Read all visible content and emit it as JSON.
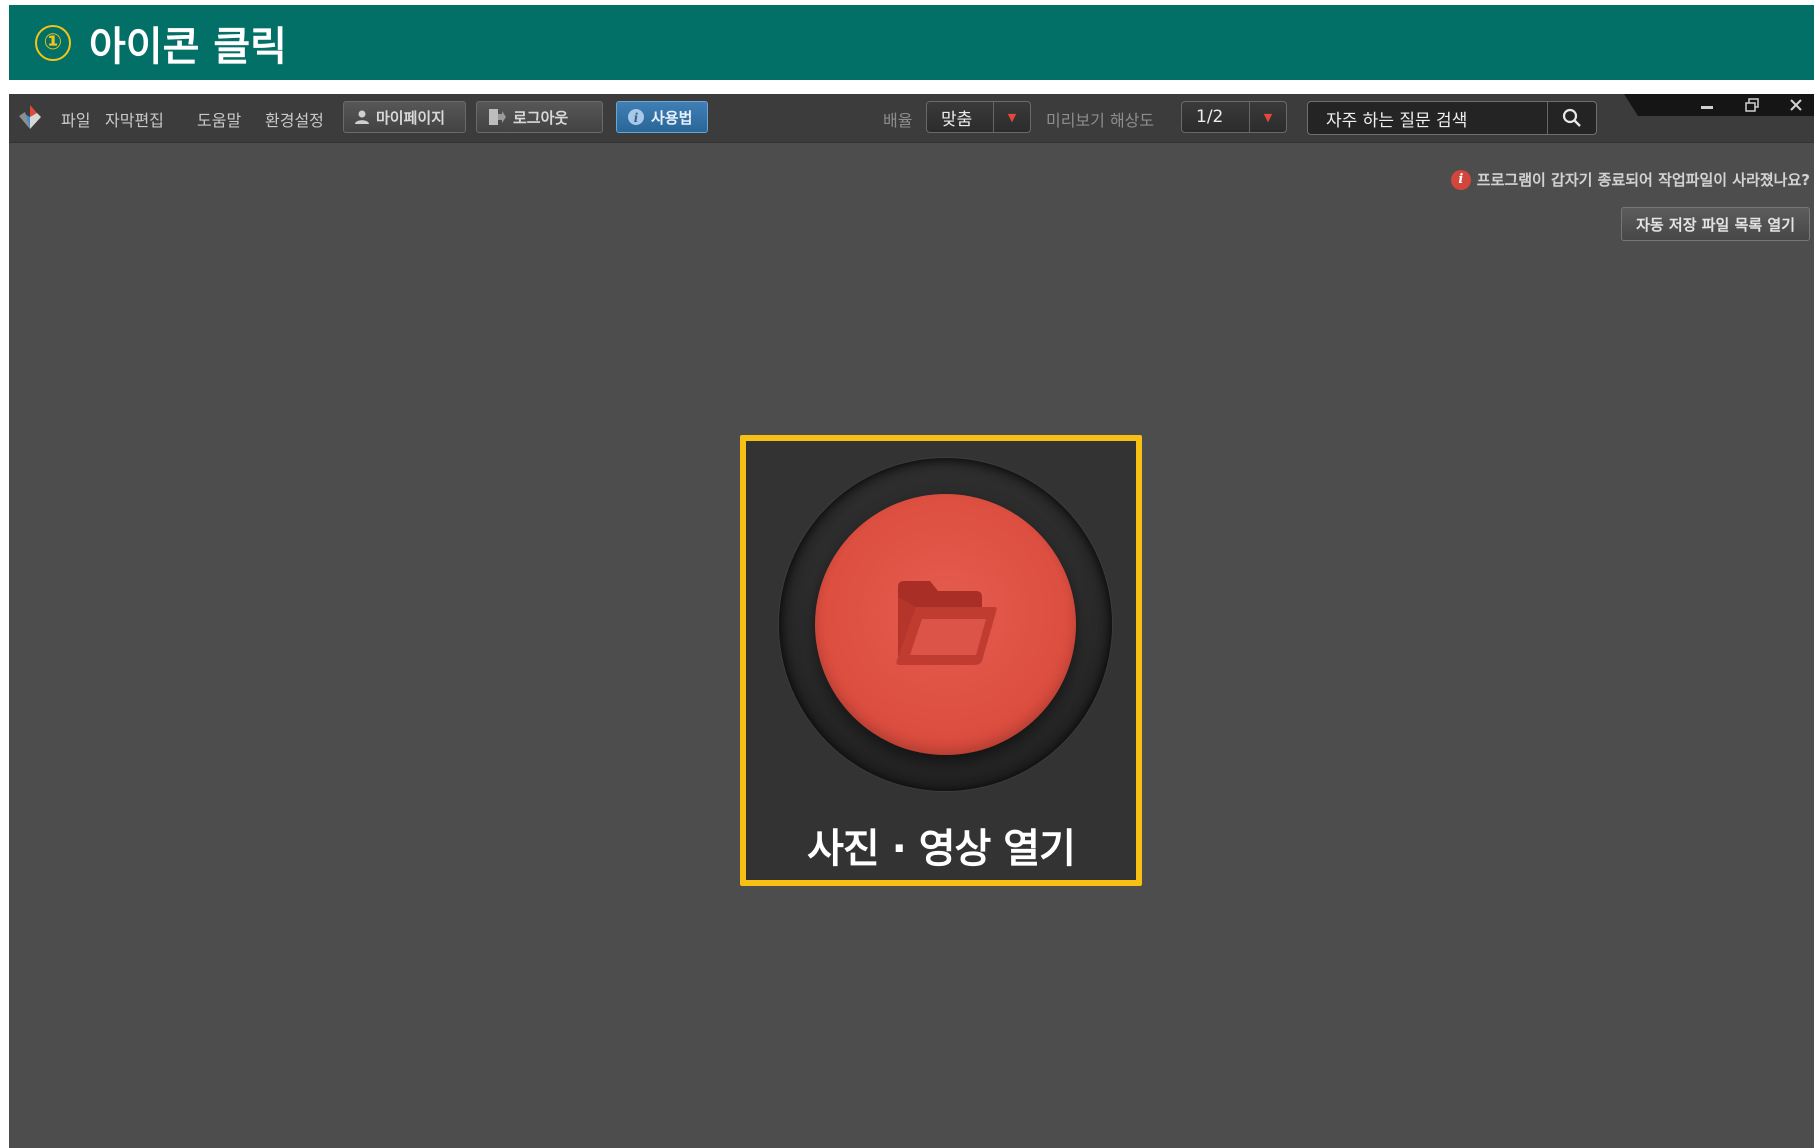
{
  "banner": {
    "step_number": "①",
    "title": "아이콘 클릭"
  },
  "toolbar": {
    "menu": [
      "파일",
      "자막편집",
      "도움말",
      "환경설정"
    ],
    "mypage_label": "마이페이지",
    "logout_label": "로그아웃",
    "usage_label": "사용법",
    "zoom_label": "배율",
    "zoom_value": "맞춤",
    "preview_label": "미리보기 해상도",
    "preview_value": "1/2",
    "search_value": "자주 하는 질문 검색"
  },
  "notice": {
    "text": "프로그램이 갑자기 종료되어 작업파일이 사라졌나요?",
    "autosave_button": "자동 저장 파일 목록 열기"
  },
  "main": {
    "open_button_label": "사진 · 영상 열기"
  },
  "colors": {
    "banner_bg": "#027066",
    "highlight": "#f8bf15",
    "accent_red": "#dc4f41",
    "app_bg": "#4d4d4d",
    "active_blue": "#2f72aa"
  },
  "icons": [
    "app-logo-icon",
    "user-icon",
    "logout-icon",
    "info-icon",
    "dropdown-icon",
    "search-icon",
    "minimize-icon",
    "restore-icon",
    "close-icon",
    "folder-icon"
  ]
}
